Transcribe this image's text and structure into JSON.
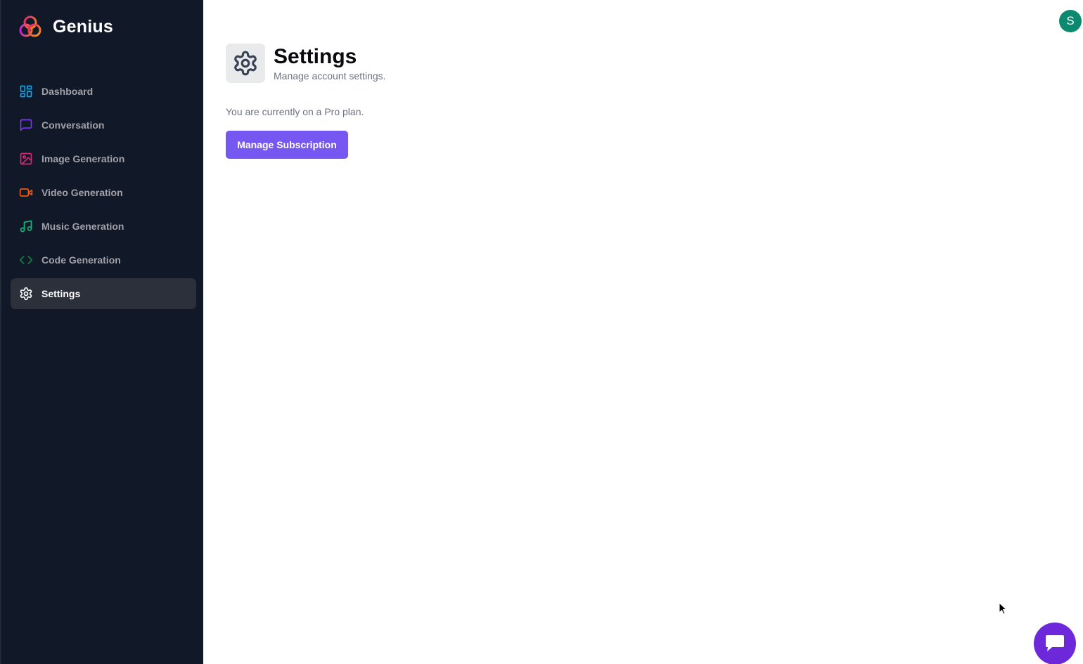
{
  "brand": {
    "name": "Genius"
  },
  "sidebar": {
    "items": [
      {
        "label": "Dashboard",
        "icon": "dashboard-icon",
        "color": "#0ea5e9",
        "active": false
      },
      {
        "label": "Conversation",
        "icon": "chat-icon",
        "color": "#7c3aed",
        "active": false
      },
      {
        "label": "Image Generation",
        "icon": "image-icon",
        "color": "#db2777",
        "active": false
      },
      {
        "label": "Video Generation",
        "icon": "video-icon",
        "color": "#ea580c",
        "active": false
      },
      {
        "label": "Music Generation",
        "icon": "music-icon",
        "color": "#10b981",
        "active": false
      },
      {
        "label": "Code Generation",
        "icon": "code-icon",
        "color": "#15803d",
        "active": false
      },
      {
        "label": "Settings",
        "icon": "gear-icon",
        "color": "#ffffff",
        "active": true
      }
    ]
  },
  "header": {
    "avatar_initial": "S",
    "avatar_color": "#0b8a6f"
  },
  "page": {
    "title": "Settings",
    "subtitle": "Manage account settings.",
    "plan_text": "You are currently on a Pro plan.",
    "manage_button": "Manage Subscription"
  },
  "colors": {
    "sidebar_bg": "#111827",
    "accent": "#7657f2",
    "chat_bubble": "#6d28d9"
  }
}
